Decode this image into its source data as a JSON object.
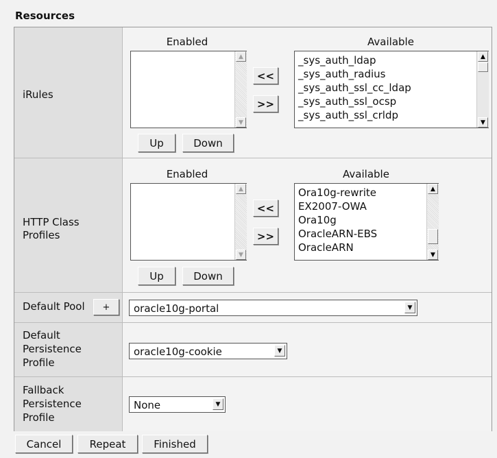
{
  "section": {
    "title": "Resources"
  },
  "irules": {
    "label": "iRules",
    "enabled_header": "Enabled",
    "available_header": "Available",
    "move_left": "<<",
    "move_right": ">>",
    "up": "Up",
    "down": "Down",
    "available_items": [
      "_sys_auth_ldap",
      "_sys_auth_radius",
      "_sys_auth_ssl_cc_ldap",
      "_sys_auth_ssl_ocsp",
      "_sys_auth_ssl_crldp"
    ]
  },
  "http_class": {
    "label_line1": "HTTP Class",
    "label_line2": "Profiles",
    "enabled_header": "Enabled",
    "available_header": "Available",
    "move_left": "<<",
    "move_right": ">>",
    "up": "Up",
    "down": "Down",
    "available_items": [
      "Ora10g-rewrite",
      "EX2007-OWA",
      "Ora10g",
      "OracleARN-EBS",
      "OracleARN"
    ]
  },
  "default_pool": {
    "label": "Default Pool",
    "add": "+",
    "value": "oracle10g-portal"
  },
  "default_persistence": {
    "label_line1": "Default",
    "label_line2": "Persistence",
    "label_line3": "Profile",
    "value": "oracle10g-cookie"
  },
  "fallback_persistence": {
    "label_line1": "Fallback",
    "label_line2": "Persistence",
    "label_line3": "Profile",
    "value": "None"
  },
  "footer": {
    "cancel": "Cancel",
    "repeat": "Repeat",
    "finished": "Finished"
  },
  "icons": {
    "scroll_up": "arrow-up-icon",
    "scroll_down": "arrow-down-icon",
    "dropdown": "chevron-down-icon"
  }
}
